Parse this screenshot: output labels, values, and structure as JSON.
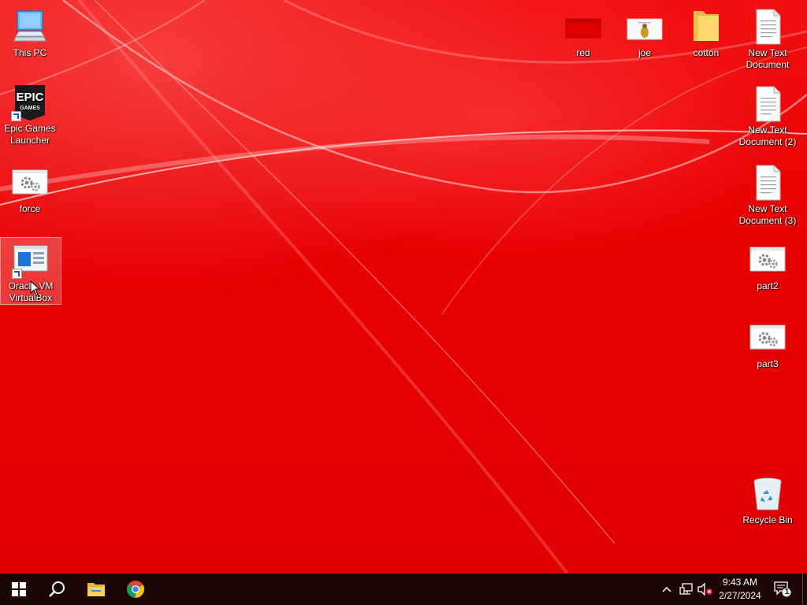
{
  "desktop": {
    "icons_left": [
      {
        "label": "This PC"
      },
      {
        "label": "Epic Games Launcher"
      },
      {
        "label": "force"
      },
      {
        "label": "Oracle VM VirtualBox"
      }
    ],
    "icons_top_right": [
      {
        "label": "red"
      },
      {
        "label": "joe"
      },
      {
        "label": "cotton"
      },
      {
        "label": "New Text Document"
      }
    ],
    "icons_right": [
      {
        "label": "New Text Document (2)"
      },
      {
        "label": "New Text Document (3)"
      },
      {
        "label": "part2"
      },
      {
        "label": "part3"
      },
      {
        "label": "Recycle Bin"
      }
    ],
    "epic_logo_text": "EPIC",
    "epic_logo_sub": "GAMES"
  },
  "taskbar": {
    "time": "9:43 AM",
    "date": "2/27/2024",
    "notification_count": "1"
  },
  "colors": {
    "wallpaper": "#e50000",
    "taskbar": "#1c0606"
  }
}
